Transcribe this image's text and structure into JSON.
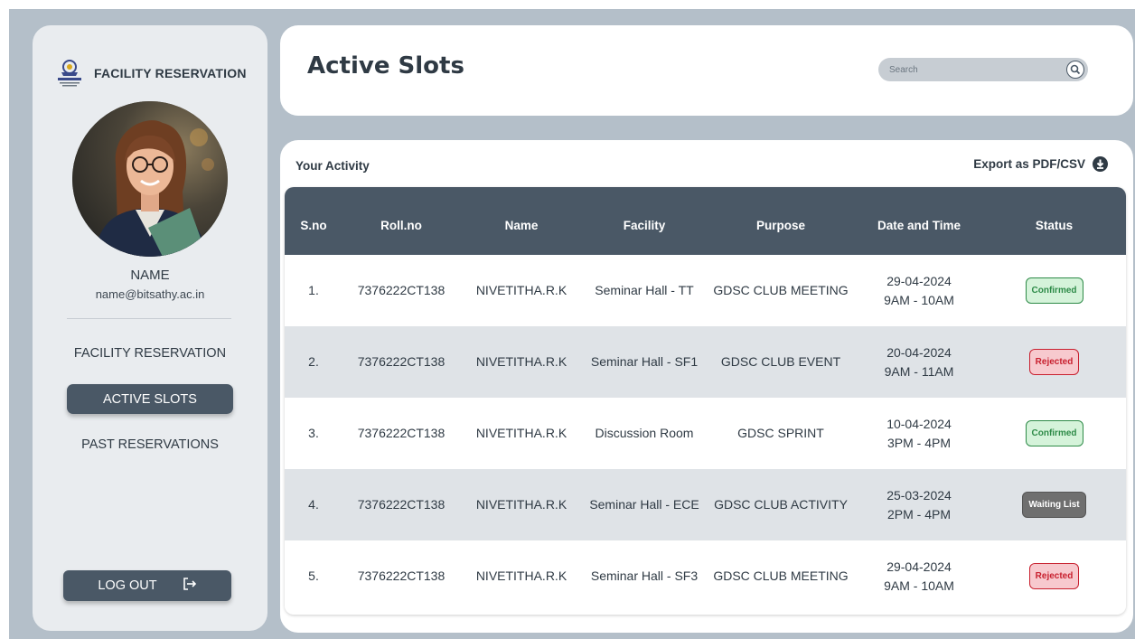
{
  "sidebar": {
    "brand_title": "FACILITY RESERVATION",
    "profile_name": "NAME",
    "profile_email": "name@bitsathy.ac.in",
    "nav_items": [
      {
        "label": "FACILITY RESERVATION"
      },
      {
        "label": "ACTIVE SLOTS",
        "active": true
      },
      {
        "label": "PAST RESERVATIONS"
      }
    ],
    "logout_label": "LOG OUT"
  },
  "header": {
    "title": "Active Slots",
    "search_placeholder": "Search"
  },
  "content": {
    "section_title": "Your Activity",
    "export_label": "Export as PDF/CSV"
  },
  "table": {
    "columns": [
      "S.no",
      "Roll.no",
      "Name",
      "Facility",
      "Purpose",
      "Date and Time",
      "Status"
    ],
    "rows": [
      {
        "sno": "1.",
        "roll": "7376222CT138",
        "name": "NIVETITHA.R.K",
        "facility": "Seminar Hall - TT",
        "purpose": "GDSC CLUB MEETING",
        "date": "29-04-2024",
        "time": "9AM - 10AM",
        "status": "Confirmed"
      },
      {
        "sno": "2.",
        "roll": "7376222CT138",
        "name": "NIVETITHA.R.K",
        "facility": "Seminar Hall - SF1",
        "purpose": "GDSC CLUB EVENT",
        "date": "20-04-2024",
        "time": "9AM - 11AM",
        "status": "Rejected"
      },
      {
        "sno": "3.",
        "roll": "7376222CT138",
        "name": "NIVETITHA.R.K",
        "facility": "Discussion Room",
        "purpose": "GDSC SPRINT",
        "date": "10-04-2024",
        "time": "3PM - 4PM",
        "status": "Confirmed"
      },
      {
        "sno": "4.",
        "roll": "7376222CT138",
        "name": "NIVETITHA.R.K",
        "facility": "Seminar Hall - ECE",
        "purpose": "GDSC CLUB ACTIVITY",
        "date": "25-03-2024",
        "time": "2PM - 4PM",
        "status": "Waiting List"
      },
      {
        "sno": "5.",
        "roll": "7376222CT138",
        "name": "NIVETITHA.R.K",
        "facility": "Seminar Hall - SF3",
        "purpose": "GDSC CLUB MEETING",
        "date": "29-04-2024",
        "time": "9AM - 10AM",
        "status": "Rejected"
      }
    ]
  },
  "colors": {
    "frame_bg": "#b4bfc9",
    "sidebar_bg": "#e9ecef",
    "primary_dark": "#4a5866",
    "row_alt": "#dfe3e7",
    "confirmed": "#2e8b48",
    "rejected": "#c8202f",
    "waiting": "#6f6f6f"
  },
  "icons": {
    "brand": "college-logo-icon",
    "search": "search-icon",
    "export": "download-icon",
    "logout": "logout-icon"
  }
}
